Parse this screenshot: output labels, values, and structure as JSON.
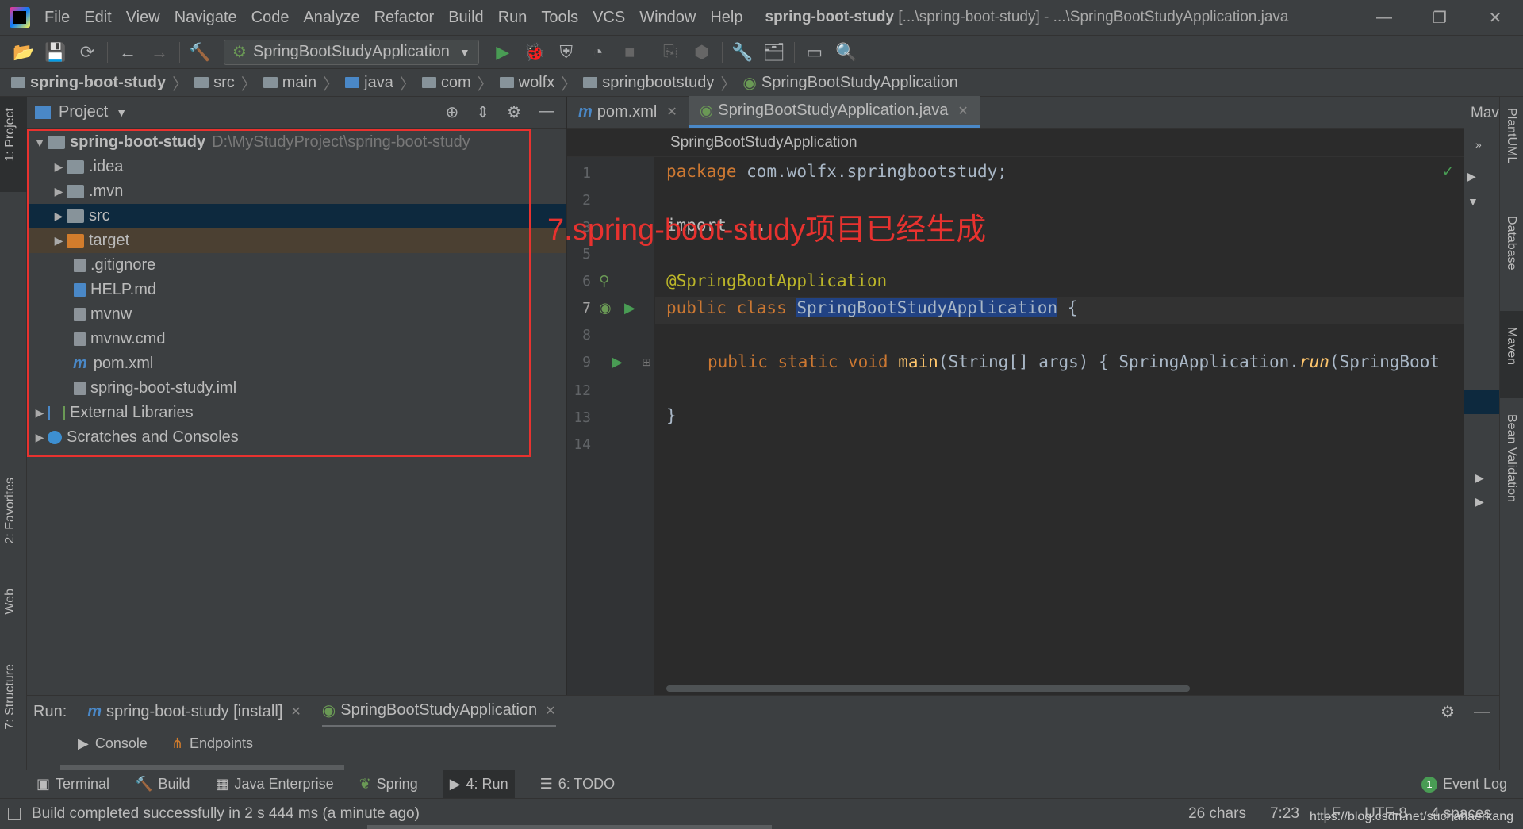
{
  "menubar": {
    "items": [
      "File",
      "Edit",
      "View",
      "Navigate",
      "Code",
      "Analyze",
      "Refactor",
      "Build",
      "Run",
      "Tools",
      "VCS",
      "Window",
      "Help"
    ],
    "title_project": "spring-boot-study",
    "title_rest": "[...\\spring-boot-study] - ...\\SpringBootStudyApplication.java",
    "minimize": "—",
    "restore": "❐",
    "close": "✕"
  },
  "toolbar": {
    "run_config": "SpringBootStudyApplication"
  },
  "breadcrumb": [
    "spring-boot-study",
    "src",
    "main",
    "java",
    "com",
    "wolfx",
    "springbootstudy",
    "SpringBootStudyApplication"
  ],
  "left_strip": {
    "project": "1: Project",
    "favorites": "2: Favorites",
    "web": "Web",
    "structure": "7: Structure"
  },
  "project": {
    "title": "Project",
    "root_name": "spring-boot-study",
    "root_path": "D:\\MyStudyProject\\spring-boot-study",
    "items": [
      ".idea",
      ".mvn",
      "src",
      "target",
      ".gitignore",
      "HELP.md",
      "mvnw",
      "mvnw.cmd",
      "pom.xml",
      "spring-boot-study.iml"
    ],
    "external": "External Libraries",
    "scratches": "Scratches and Consoles"
  },
  "editor": {
    "tabs": [
      "pom.xml",
      "SpringBootStudyApplication.java"
    ],
    "breadcrumb": "SpringBootStudyApplication",
    "line_numbers": [
      "1",
      "2",
      "3",
      "5",
      "6",
      "7",
      "8",
      "9",
      "12",
      "13",
      "14"
    ],
    "code": {
      "l1_kw": "package",
      "l1_rest": " com.wolfx.springbootstudy;",
      "l3": "import ...",
      "l6_at": "@",
      "l6_ann": "SpringBootApplication",
      "l7_kw": "public class ",
      "l7_cls": "SpringBootStudyApplication",
      "l7_rest": " {",
      "l9_kw": "public static void ",
      "l9_fn": "main",
      "l9_args": "(String[] args) ",
      "l9_brace": "{ SpringApplication.",
      "l9_run": "run",
      "l9_tail": "(SpringBoot",
      "l13": "}"
    },
    "annotation": "7.spring-boot-study项目已经生成"
  },
  "right_strip": {
    "maven_stub": "Mav",
    "plantuml": "PlantUML",
    "database": "Database",
    "maven": "Maven",
    "bean": "Bean Validation"
  },
  "run_panel": {
    "label": "Run:",
    "tabs": [
      "spring-boot-study [install]",
      "SpringBootStudyApplication"
    ],
    "subtabs": [
      "Console",
      "Endpoints"
    ]
  },
  "bottom_tabs": [
    "Terminal",
    "Build",
    "Java Enterprise",
    "Spring",
    "4: Run",
    "6: TODO"
  ],
  "event_log": "Event Log",
  "event_count": "1",
  "status": {
    "message": "Build completed successfully in 2 s 444 ms (a minute ago)",
    "chars": "26 chars",
    "position": "7:23",
    "line_sep": "LF",
    "encoding": "UTF-8",
    "indent": "4 spaces"
  },
  "watermark": "https://blog.csdn.net/suchahaerkang"
}
